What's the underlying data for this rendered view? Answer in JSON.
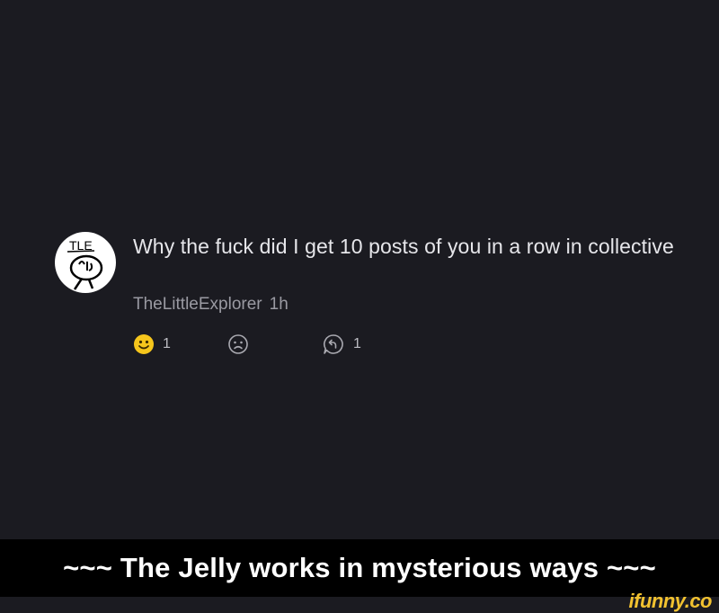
{
  "post": {
    "avatar_text": "TLE",
    "body": "Why the fuck did I get 10 posts of you in a row in collective",
    "author": "TheLittleExplorer",
    "time": "1h",
    "reactions": {
      "like_icon": "smile-emoji-icon",
      "like_count": "1",
      "dislike_icon": "frown-face-icon",
      "reply_icon": "reply-bubble-icon",
      "reply_count": "1"
    }
  },
  "caption": "~~~ The Jelly works in mysterious ways ~~~",
  "watermark": "ifunny.co",
  "colors": {
    "background": "#1b1b21",
    "caption_bar": "#000000",
    "body_text": "#e6e6ea",
    "meta_text": "#9a9aa2",
    "emoji_yellow": "#f6c61c",
    "watermark": "#f2c230"
  }
}
